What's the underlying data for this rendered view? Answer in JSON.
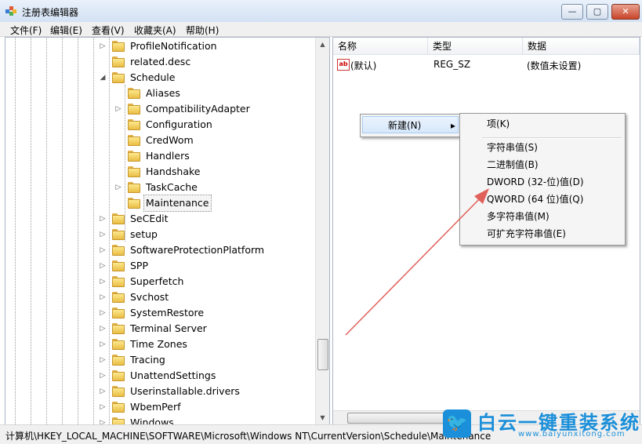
{
  "window": {
    "title": "注册表编辑器",
    "controls": {
      "minimize": "—",
      "maximize": "▢",
      "close": "✕"
    }
  },
  "menubar": [
    "文件(F)",
    "编辑(E)",
    "查看(V)",
    "收藏夹(A)",
    "帮助(H)"
  ],
  "tree": {
    "level1": [
      {
        "label": "ProfileNotification",
        "expander": "▷"
      },
      {
        "label": "related.desc",
        "expander": ""
      },
      {
        "label": "Schedule",
        "expander": "◢"
      }
    ],
    "schedule_children": [
      {
        "label": "Aliases",
        "expander": ""
      },
      {
        "label": "CompatibilityAdapter",
        "expander": "▷"
      },
      {
        "label": "Configuration",
        "expander": ""
      },
      {
        "label": "CredWom",
        "expander": ""
      },
      {
        "label": "Handlers",
        "expander": ""
      },
      {
        "label": "Handshake",
        "expander": ""
      },
      {
        "label": "TaskCache",
        "expander": "▷"
      },
      {
        "label": "Maintenance",
        "expander": "",
        "selected": true
      }
    ],
    "level1_after": [
      {
        "label": "SeCEdit",
        "expander": "▷"
      },
      {
        "label": "setup",
        "expander": "▷"
      },
      {
        "label": "SoftwareProtectionPlatform",
        "expander": "▷"
      },
      {
        "label": "SPP",
        "expander": "▷"
      },
      {
        "label": "Superfetch",
        "expander": "▷"
      },
      {
        "label": "Svchost",
        "expander": "▷"
      },
      {
        "label": "SystemRestore",
        "expander": "▷"
      },
      {
        "label": "Terminal Server",
        "expander": "▷"
      },
      {
        "label": "Time Zones",
        "expander": "▷"
      },
      {
        "label": "Tracing",
        "expander": "▷"
      },
      {
        "label": "UnattendSettings",
        "expander": "▷"
      },
      {
        "label": "Userinstallable.drivers",
        "expander": "▷"
      },
      {
        "label": "WbemPerf",
        "expander": "▷"
      },
      {
        "label": "Windows",
        "expander": "▷"
      }
    ]
  },
  "list": {
    "columns": [
      "名称",
      "类型",
      "数据"
    ],
    "rows": [
      {
        "icon": "ab",
        "name": "(默认)",
        "type": "REG_SZ",
        "data": "(数值未设置)"
      }
    ]
  },
  "context_menu": {
    "parent": {
      "label": "新建(N)",
      "arrow": "▸"
    },
    "groups": [
      [
        "项(K)"
      ],
      [
        "字符串值(S)",
        "二进制值(B)",
        "DWORD (32-位)值(D)",
        "QWORD (64 位)值(Q)",
        "多字符串值(M)",
        "可扩充字符串值(E)"
      ]
    ]
  },
  "statusbar": {
    "path": "计算机\\HKEY_LOCAL_MACHINE\\SOFTWARE\\Microsoft\\Windows NT\\CurrentVersion\\Schedule\\Maintenance"
  },
  "watermark": {
    "brand": "白云一键重装系统",
    "url": "www.baiyunxitong.com"
  },
  "annotation_color": "#e0605a"
}
